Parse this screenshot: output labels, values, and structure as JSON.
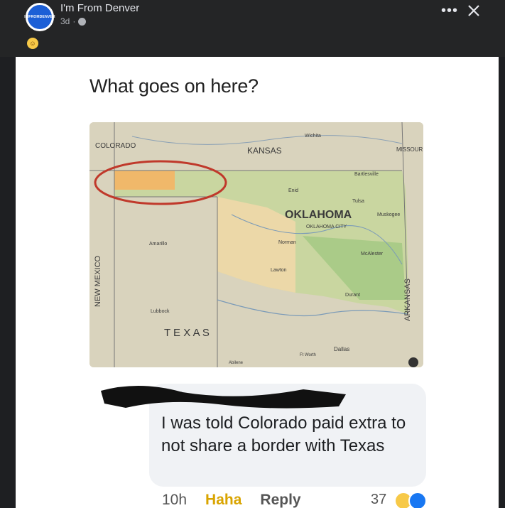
{
  "header": {
    "page_name": "I'm From Denver",
    "timestamp": "3d",
    "avatar_text": "IMFROMDENVER"
  },
  "post": {
    "title": "What goes on here?"
  },
  "map": {
    "labels": {
      "colorado": "COLORADO",
      "kansas": "KANSAS",
      "missouri": "MISSOUR",
      "oklahoma": "OKLAHOMA",
      "arkansas": "ARKANSAS",
      "new_mexico": "NEW MEXICO",
      "texas": "T E X A S",
      "wichita": "Wichita",
      "bartlesville": "Bartlesville",
      "enid": "Enid",
      "tulsa": "Tulsa",
      "muskogee": "Muskogee",
      "okc": "OKLAHOMA CITY",
      "norman": "Norman",
      "mcalester": "McAlester",
      "amarillo": "Amarillo",
      "lawton": "Lawton",
      "durant": "Durant",
      "lubbock": "Lubbock",
      "dallas": "Dallas",
      "ftworth": "Ft Worth",
      "abilene": "Abilene"
    }
  },
  "comment": {
    "text": "I was told Colorado paid extra to not share a border with Texas",
    "time": "10h",
    "haha_label": "Haha",
    "reply_label": "Reply",
    "reaction_count": "37"
  },
  "colors": {
    "accent_blue": "#1c5fd6",
    "haha_yellow": "#d9a400",
    "circle_red": "#c0392b"
  }
}
